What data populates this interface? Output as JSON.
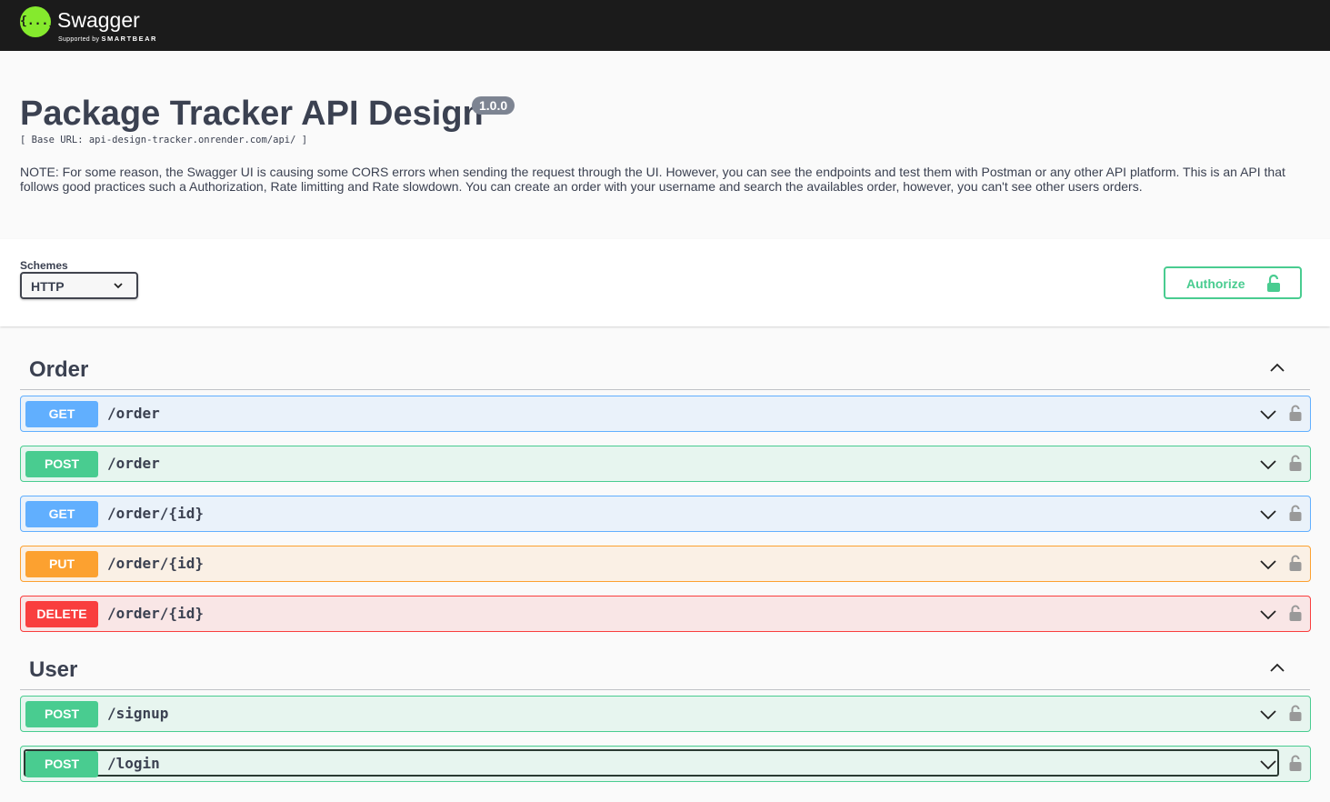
{
  "topbar": {
    "brand": "Swagger",
    "supported_by": "Supported by",
    "company": "SMARTBEAR",
    "logo_glyph": "{...}",
    "logo_color": "#85ea2d"
  },
  "info": {
    "title": "Package Tracker API Design",
    "version": "1.0.0",
    "base_url": "[ Base URL: api-design-tracker.onrender.com/api/ ]",
    "description": "NOTE: For some reason, the Swagger UI is causing some CORS errors when sending the request through the UI. However, you can see the endpoints and test them with Postman or any other API platform. This is an API that follows good practices such a Authorization, Rate limitting and Rate slowdown. You can create an order with your username and search the availables order, however, you can't see other users orders."
  },
  "schemes": {
    "label": "Schemes",
    "selected": "HTTP"
  },
  "authorize": {
    "label": "Authorize",
    "icon": "unlocked-lock-icon",
    "color": "#49cc90"
  },
  "tags": [
    {
      "name": "Order",
      "operations": [
        {
          "method": "GET",
          "path": "/order"
        },
        {
          "method": "POST",
          "path": "/order"
        },
        {
          "method": "GET",
          "path": "/order/{id}"
        },
        {
          "method": "PUT",
          "path": "/order/{id}"
        },
        {
          "method": "DELETE",
          "path": "/order/{id}"
        }
      ]
    },
    {
      "name": "User",
      "operations": [
        {
          "method": "POST",
          "path": "/signup"
        },
        {
          "method": "POST",
          "path": "/login"
        }
      ]
    }
  ],
  "method_colors": {
    "GET": "#61affe",
    "POST": "#49cc90",
    "PUT": "#fca130",
    "DELETE": "#f93e3e"
  }
}
